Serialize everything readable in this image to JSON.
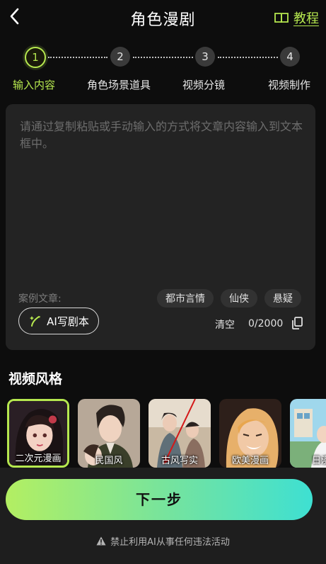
{
  "header": {
    "title": "角色漫剧",
    "tutorial_label": "教程",
    "back_icon": "chevron-left-icon",
    "tutorial_icon": "book-icon"
  },
  "steps": [
    {
      "number": "1",
      "label": "输入内容",
      "active": true
    },
    {
      "number": "2",
      "label": "角色场景道具",
      "active": false
    },
    {
      "number": "3",
      "label": "视频分镜",
      "active": false
    },
    {
      "number": "4",
      "label": "视频制作",
      "active": false
    }
  ],
  "editor": {
    "placeholder": "请通过复制粘贴或手动输入的方式将文章内容输入到文本框中。",
    "examples_label": "案例文章:",
    "example_tags": [
      "都市言情",
      "仙侠",
      "悬疑"
    ],
    "ai_button_label": "AI写剧本",
    "clear_label": "清空",
    "char_count": "0/2000"
  },
  "styles_section": {
    "title": "视频风格",
    "items": [
      {
        "label": "二次元漫画",
        "selected": true
      },
      {
        "label": "民国风",
        "selected": false
      },
      {
        "label": "古风写实",
        "selected": false
      },
      {
        "label": "欧美漫画",
        "selected": false
      },
      {
        "label": "日漫",
        "selected": false
      }
    ]
  },
  "footer": {
    "next_label": "下一步",
    "notice": "禁止利用AI从事任何违法活动"
  },
  "colors": {
    "accent": "#b6e84f",
    "background": "#0d0d0d",
    "panel": "#232323",
    "button_gradient_start": "#b3ef62",
    "button_gradient_end": "#3ee0d2"
  }
}
